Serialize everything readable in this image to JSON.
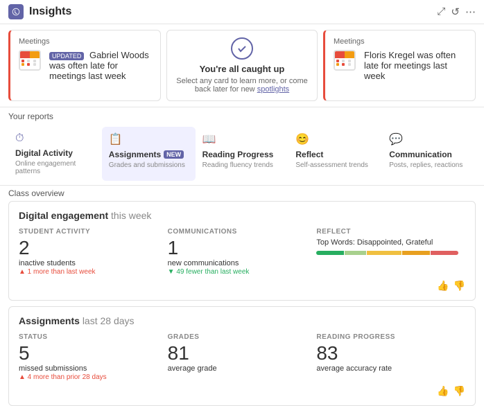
{
  "header": {
    "title": "Insights",
    "expand_label": "⤢",
    "refresh_label": "↺",
    "more_label": "⋯"
  },
  "spotlights": {
    "card1": {
      "section": "Meetings",
      "badge": "UPDATED",
      "text": "Gabriel Woods was often late for meetings last week"
    },
    "card2": {
      "title": "You're all caught up",
      "subtitle": "Select any card to learn more, or come back later for new",
      "link": "spotlights"
    },
    "card3": {
      "section": "Meetings",
      "text": "Floris Kregel was often late for meetings last week"
    }
  },
  "reports": {
    "section_label": "Your reports",
    "items": [
      {
        "id": "digital",
        "icon": "⏱",
        "name": "Digital Activity",
        "sub": "Online engagement patterns",
        "new": false,
        "active": false
      },
      {
        "id": "assignments",
        "icon": "📋",
        "name": "Assignments",
        "sub": "Grades and submissions",
        "new": true,
        "active": true
      },
      {
        "id": "reading",
        "icon": "📖",
        "name": "Reading Progress",
        "sub": "Reading fluency trends",
        "new": false,
        "active": false
      },
      {
        "id": "reflect",
        "icon": "😊",
        "name": "Reflect",
        "sub": "Self-assessment trends",
        "new": false,
        "active": false
      },
      {
        "id": "communication",
        "icon": "💬",
        "name": "Communication",
        "sub": "Posts, replies, reactions",
        "new": false,
        "active": false
      }
    ]
  },
  "class_overview": {
    "section_label": "Class overview",
    "digital": {
      "title": "Digital engagement",
      "period": "this week",
      "student_activity_label": "STUDENT ACTIVITY",
      "student_value": "2",
      "student_desc": "inactive students",
      "student_change": "▲ 1 more than last week",
      "comms_label": "COMMUNICATIONS",
      "comms_value": "1",
      "comms_desc": "new communications",
      "comms_change": "▼ 49 fewer than last week",
      "reflect_label": "REFLECT",
      "reflect_words": "Top Words: Disappointed, Grateful",
      "reflect_bars": [
        {
          "color": "#27ae60",
          "pct": 20
        },
        {
          "color": "#a8d08d",
          "pct": 15
        },
        {
          "color": "#f0c040",
          "pct": 25
        },
        {
          "color": "#e8a020",
          "pct": 20
        },
        {
          "color": "#e06060",
          "pct": 20
        }
      ]
    },
    "assignments": {
      "title": "Assignments",
      "period": "last 28 days",
      "status_label": "STATUS",
      "status_value": "5",
      "status_desc": "missed submissions",
      "status_change": "▲ 4 more than prior 28 days",
      "grades_label": "GRADES",
      "grades_value": "81",
      "grades_desc": "average grade",
      "reading_label": "READING PROGRESS",
      "reading_value": "83",
      "reading_desc": "average accuracy rate"
    }
  }
}
